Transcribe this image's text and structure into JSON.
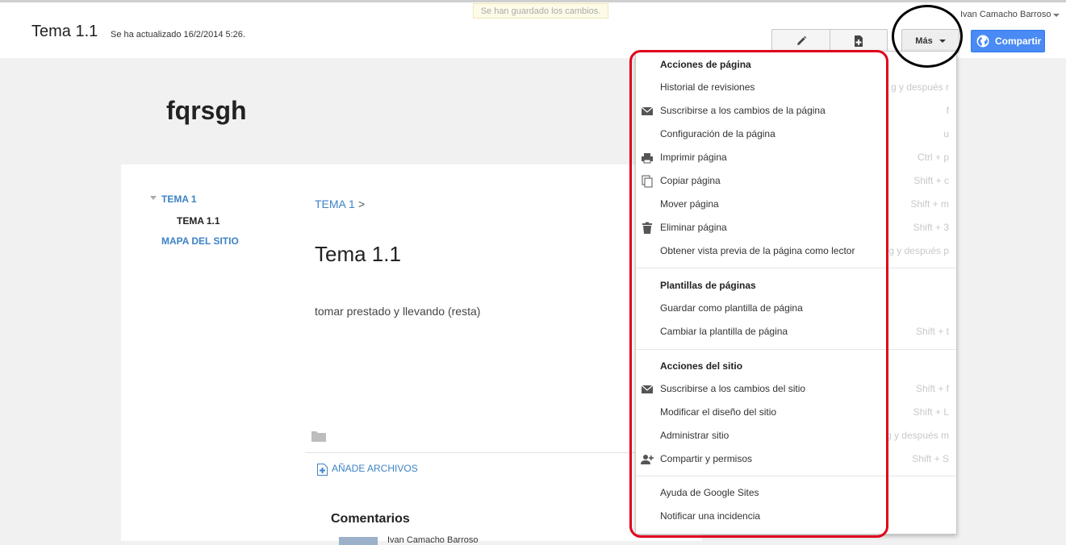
{
  "header": {
    "page_title": "Tema 1.1",
    "updated": "Se ha actualizado 16/2/2014 5:26.",
    "saved_message": "Se han guardado los cambios.",
    "user_name": "Ivan Camacho Barroso",
    "more_label": "Más",
    "share_label": "Compartir",
    "share_color": "#4a8af4"
  },
  "site": {
    "name": "fqrsgh",
    "nav": [
      "TEMA 1",
      "TEMA 1.1",
      "MAPA DEL SITIO"
    ]
  },
  "content": {
    "breadcrumb_link": "TEMA 1",
    "breadcrumb_sep": ">",
    "title": "Tema 1.1",
    "text": "tomar prestado y llevando (resta)",
    "add_files": "AÑADE ARCHIVOS",
    "comments_title": "Comentarios",
    "comment_author": "Ivan Camacho Barroso"
  },
  "menu": {
    "sections": [
      "Acciones de página",
      "Plantillas de páginas",
      "Acciones del sitio"
    ],
    "items": [
      {
        "label": "Historial de revisiones",
        "shortcut": "g y después r",
        "icon": ""
      },
      {
        "label": "Suscribirse a los cambios de la página",
        "shortcut": "f",
        "icon": "mail-icon"
      },
      {
        "label": "Configuración de la página",
        "shortcut": "u",
        "icon": ""
      },
      {
        "label": "Imprimir página",
        "shortcut": "Ctrl + p",
        "icon": "printer-icon"
      },
      {
        "label": "Copiar página",
        "shortcut": "Shift + c",
        "icon": "copy-icon"
      },
      {
        "label": "Mover página",
        "shortcut": "Shift + m",
        "icon": ""
      },
      {
        "label": "Eliminar página",
        "shortcut": "Shift + 3",
        "icon": "trash-icon"
      },
      {
        "label": "Obtener vista previa de la página como lector",
        "shortcut": "g y después p",
        "icon": ""
      },
      {
        "label": "Guardar como plantilla de página",
        "shortcut": "",
        "icon": ""
      },
      {
        "label": "Cambiar la plantilla de página",
        "shortcut": "Shift + t",
        "icon": ""
      },
      {
        "label": "Suscribirse a los cambios del sitio",
        "shortcut": "Shift + f",
        "icon": "mail-icon"
      },
      {
        "label": "Modificar el diseño del sitio",
        "shortcut": "Shift + L",
        "icon": ""
      },
      {
        "label": "Administrar sitio",
        "shortcut": "g y después m",
        "icon": ""
      },
      {
        "label": "Compartir y permisos",
        "shortcut": "Shift + S",
        "icon": "add-person-icon"
      },
      {
        "label": "Ayuda de Google Sites",
        "shortcut": "",
        "icon": ""
      },
      {
        "label": "Notificar una incidencia",
        "shortcut": "",
        "icon": ""
      }
    ]
  },
  "annotations": {
    "ellipse_color": "#000000",
    "rect_color": "#e0001b"
  }
}
